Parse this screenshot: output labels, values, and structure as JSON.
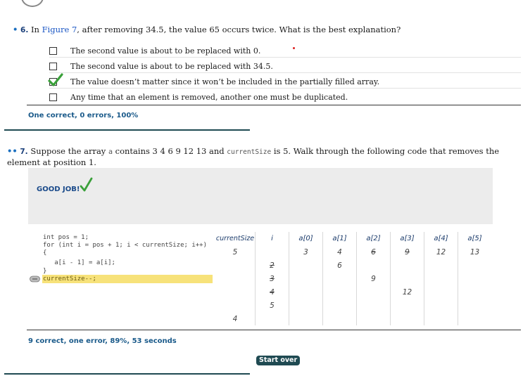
{
  "q6": {
    "bullet": "•",
    "number": "6.",
    "text_before": "In",
    "figure_link": "Figure 7",
    "text_after": ", after removing 34.5, the value 65 occurs twice. What is the best explanation?",
    "choices": [
      {
        "label": "The second value is about to be replaced with 0.",
        "checked": false
      },
      {
        "label": "The second value is about to be replaced with 34.5.",
        "checked": false
      },
      {
        "label": "The value doesn’t matter since it won’t be included in the partially filled array.",
        "checked": true
      },
      {
        "label": "Any time that an element is removed, another one must be duplicated.",
        "checked": false
      }
    ],
    "score": "One correct, 0 errors, 100%"
  },
  "q7": {
    "bullet": "••",
    "number": "7.",
    "text_a": "Suppose the array",
    "array_name": "a",
    "text_b": "contains 3 4 6 9 12 13 and",
    "var_name": "currentSize",
    "text_c": "is 5. Walk through the following code that removes the element at position 1.",
    "feedback": "GOOD JOB!",
    "code_lines": [
      "int pos = 1;",
      "for (int i = pos + 1; i < currentSize; i++)",
      "{",
      "   a[i - 1] = a[i];",
      "}",
      "currentSize--;"
    ],
    "trace": {
      "headers": [
        "currentSize",
        "i",
        "a[0]",
        "a[1]",
        "a[2]",
        "a[3]",
        "a[4]",
        "a[5]"
      ],
      "rows": [
        [
          "5",
          "",
          "3",
          "4",
          "6",
          "9",
          "12",
          "13"
        ],
        [
          "",
          "2",
          "",
          "6",
          "",
          "",
          "",
          ""
        ],
        [
          "",
          "3",
          "",
          "",
          "9",
          "",
          "",
          ""
        ],
        [
          "",
          "4",
          "",
          "",
          "",
          "12",
          "",
          ""
        ],
        [
          "",
          "5",
          "",
          "",
          "",
          "",
          "",
          ""
        ],
        [
          "4",
          "",
          "",
          "",
          "",
          "",
          "",
          ""
        ]
      ]
    },
    "score": "9 correct, one error, 89%, 53 seconds",
    "start_over": "Start over"
  },
  "colors": {
    "accent_link": "#1a56c4",
    "score_blue": "#1a5a8a",
    "teal_rule": "#1f4a52",
    "highlight": "#f7e27a",
    "check_green": "#3aa03a"
  }
}
